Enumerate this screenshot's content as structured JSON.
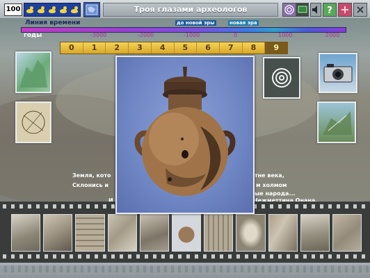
{
  "toolbar": {
    "score": "100",
    "title": "Троя глазами археологов",
    "duck_count": 5
  },
  "timeline": {
    "label": "Линия времени",
    "years_label": "годы",
    "era_bc": "до новой эры",
    "era_ad": "новая эра",
    "ticks": [
      "-3000",
      "-2000",
      "-1000",
      "0",
      "1000",
      "2000"
    ]
  },
  "slots": {
    "items": [
      "0",
      "1",
      "2",
      "3",
      "4",
      "5",
      "6",
      "7",
      "8",
      "9"
    ],
    "active": "9"
  },
  "story": {
    "line1_left": "Земля, кото",
    "line1_right": "тне века,",
    "line2_left": "Склонись и",
    "line2_right": "м холмом",
    "line3_right": "ые народа...",
    "line4_left": "И",
    "line4_right": "Нежметтина Онана."
  },
  "colors": {
    "accent": "#1e3f9e",
    "slot_gold": "#e8c04a",
    "timeline_magenta": "#b02aa0"
  },
  "icons": {
    "speaker": "speaker-icon",
    "help": "help-icon",
    "close": "close-icon",
    "spiral": "spiral-icon",
    "map": "map-icon"
  }
}
